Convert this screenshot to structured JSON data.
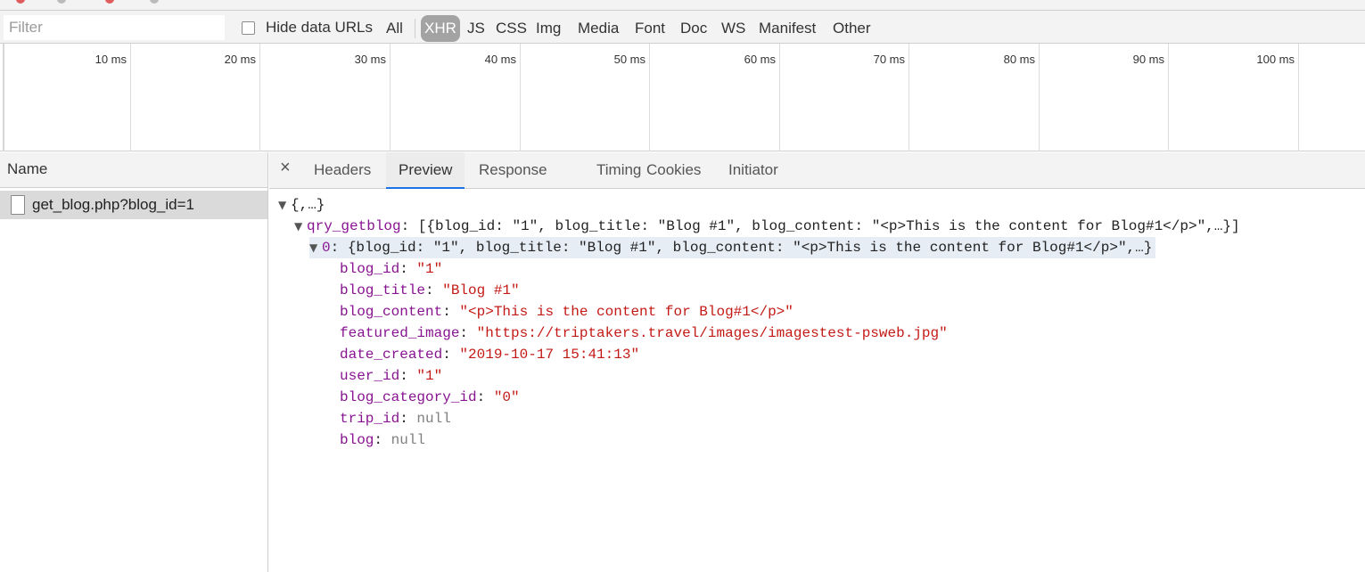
{
  "filter": {
    "placeholder": "Filter"
  },
  "hide_data_urls_label": "Hide data URLs",
  "type_filters": [
    "All",
    "XHR",
    "JS",
    "CSS",
    "Img",
    "Media",
    "Font",
    "Doc",
    "WS",
    "Manifest",
    "Other"
  ],
  "active_type": "XHR",
  "timeline": {
    "ticks": [
      "10 ms",
      "20 ms",
      "30 ms",
      "40 ms",
      "50 ms",
      "60 ms",
      "70 ms",
      "80 ms",
      "90 ms",
      "100 ms"
    ]
  },
  "name_column": {
    "header": "Name",
    "requests": [
      "get_blog.php?blog_id=1"
    ]
  },
  "details": {
    "close_glyph": "×",
    "tabs": [
      "Headers",
      "Preview",
      "Response",
      "Timing",
      "Cookies",
      "Initiator"
    ],
    "active_tab": "Preview"
  },
  "preview": {
    "root": "{,…}",
    "qry_key": "qry_getblog",
    "qry_summary": "[{blog_id: \"1\", blog_title: \"Blog #1\", blog_content: \"<p>This is the content for Blog#1</p>\",…}]",
    "item_index": "0",
    "item_summary": "{blog_id: \"1\", blog_title: \"Blog #1\", blog_content: \"<p>This is the content for Blog#1</p>\",…}",
    "fields": [
      {
        "key": "blog_id",
        "value": "\"1\"",
        "type": "string"
      },
      {
        "key": "blog_title",
        "value": "\"Blog #1\"",
        "type": "string"
      },
      {
        "key": "blog_content",
        "value": "\"<p>This is the content for Blog#1</p>\"",
        "type": "string"
      },
      {
        "key": "featured_image",
        "value": "\"https://triptakers.travel/images/imagestest-psweb.jpg\"",
        "type": "string"
      },
      {
        "key": "date_created",
        "value": "\"2019-10-17 15:41:13\"",
        "type": "string"
      },
      {
        "key": "user_id",
        "value": "\"1\"",
        "type": "string"
      },
      {
        "key": "blog_category_id",
        "value": "\"0\"",
        "type": "string"
      },
      {
        "key": "trip_id",
        "value": "null",
        "type": "null"
      },
      {
        "key": "blog",
        "value": "null",
        "type": "null"
      }
    ]
  },
  "colors": {
    "active_tab_underline": "#1a73e8",
    "active_filter_bg": "#a3a3a3",
    "key": "#881391",
    "string": "#c41a16",
    "null": "#808080"
  }
}
